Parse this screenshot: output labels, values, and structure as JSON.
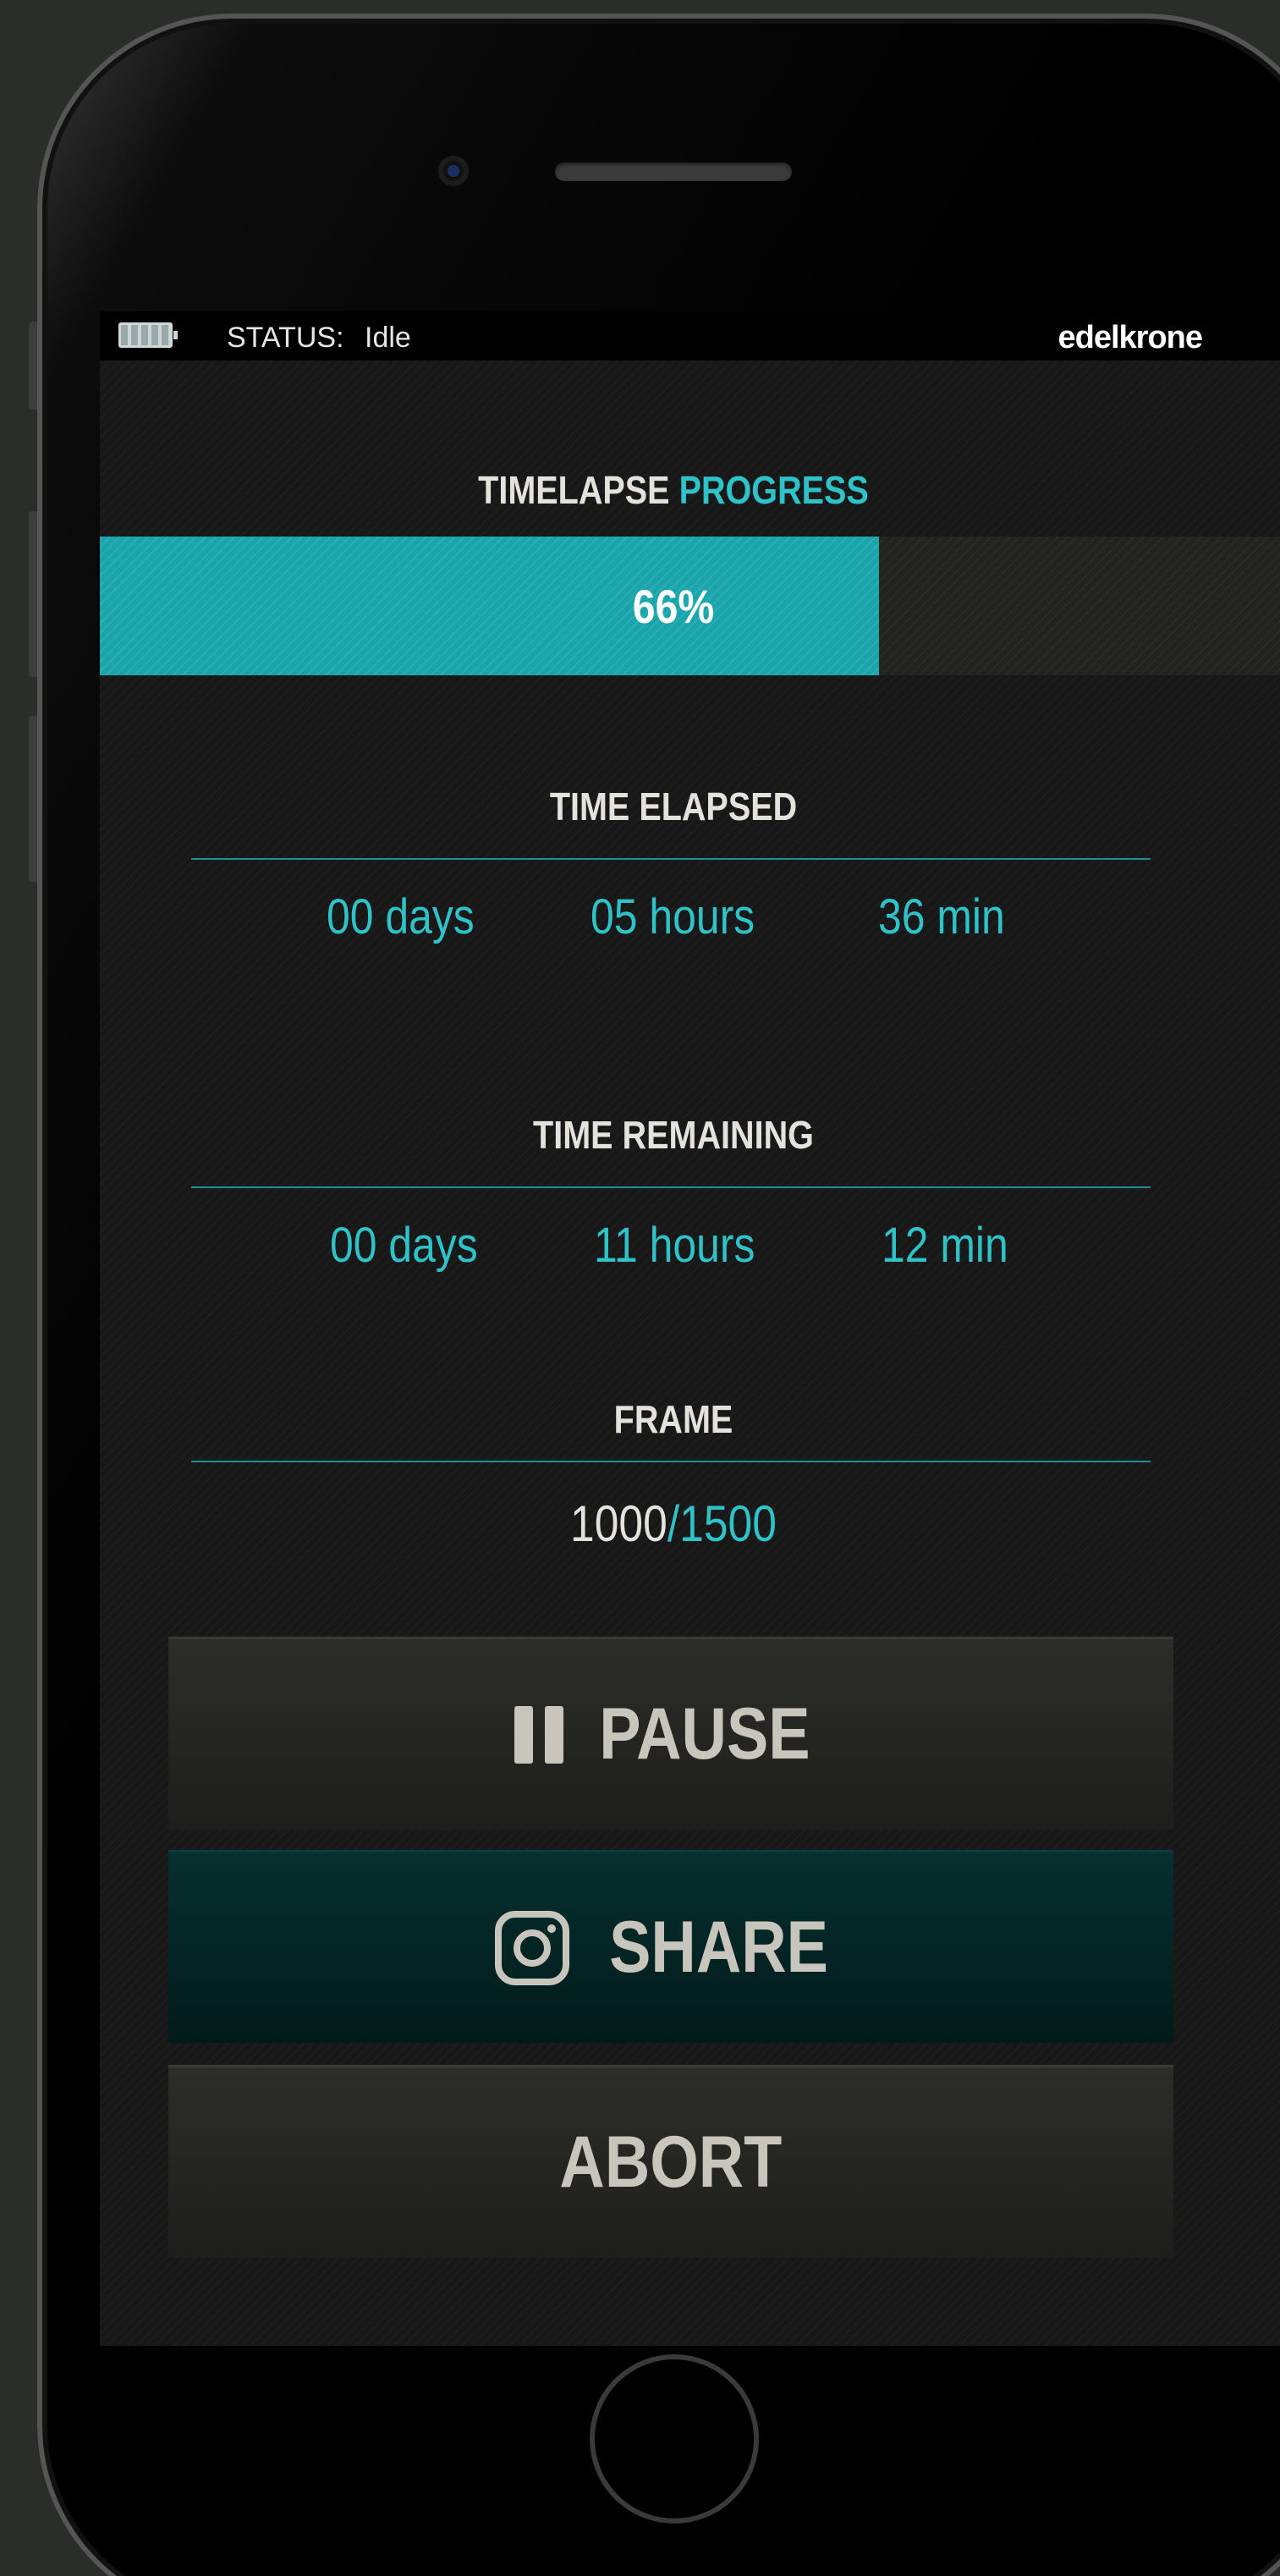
{
  "status_bar": {
    "status_label": "STATUS:",
    "status_value": "Idle",
    "brand": "edelkrone",
    "battery_icon": "battery-icon"
  },
  "progress": {
    "title_part1": "TIMELAPSE",
    "title_part2": "PROGRESS",
    "percent_text": "66%",
    "percent_value": 66
  },
  "time_elapsed": {
    "title": "TIME ELAPSED",
    "days": "00 days",
    "hours": "05 hours",
    "minutes": "36 min"
  },
  "time_remaining": {
    "title": "TIME REMAINING",
    "days": "00 days",
    "hours": "11 hours",
    "minutes": "12 min"
  },
  "frame": {
    "title": "FRAME",
    "current": "1000",
    "separator": "/",
    "total": "1500"
  },
  "actions": {
    "pause_label": "PAUSE",
    "share_label": "SHARE",
    "abort_label": "ABORT",
    "pause_icon": "pause-icon",
    "share_icon": "instagram-icon"
  },
  "colors": {
    "accent": "#2ec3c8",
    "progress_fill": "#1aa5ad",
    "background": "#181818",
    "share_button": "#03201f"
  }
}
